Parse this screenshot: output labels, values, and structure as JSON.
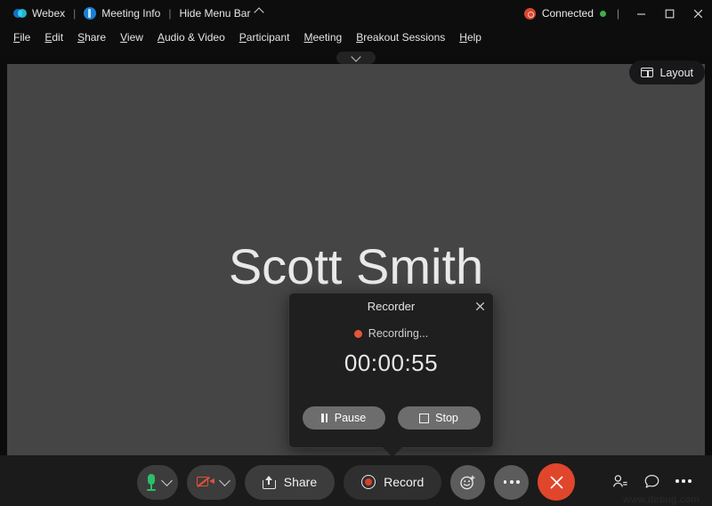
{
  "titlebar": {
    "app_name": "Webex",
    "separator1": "|",
    "meeting_info": "Meeting Info",
    "separator2": "|",
    "hide_menu_bar": "Hide Menu Bar",
    "connection_status": "Connected",
    "vbar": "|",
    "minimize_label": "Minimize",
    "maximize_label": "Maximize",
    "close_label": "Close",
    "accent_red": "#d6472f",
    "accent_green": "#3fae4a"
  },
  "menubar": {
    "items": [
      {
        "pre": "",
        "key": "F",
        "post": "ile"
      },
      {
        "pre": "",
        "key": "E",
        "post": "dit"
      },
      {
        "pre": "",
        "key": "S",
        "post": "hare"
      },
      {
        "pre": "",
        "key": "V",
        "post": "iew"
      },
      {
        "pre": "",
        "key": "A",
        "post": "udio & Video"
      },
      {
        "pre": "",
        "key": "P",
        "post": "articipant"
      },
      {
        "pre": "",
        "key": "M",
        "post": "eeting"
      },
      {
        "pre": "",
        "key": "B",
        "post": "reakout Sessions"
      },
      {
        "pre": "",
        "key": "H",
        "post": "elp"
      }
    ]
  },
  "stage": {
    "speaker_name": "Scott Smith",
    "background_color": "#454545",
    "collapse_toggle_label": "Collapse controls"
  },
  "layout": {
    "label": "Layout"
  },
  "recorder": {
    "title": "Recorder",
    "close_label": "Close recorder",
    "status_text": "Recording...",
    "status_dot_color": "#e8543c",
    "timer": "00:00:55",
    "pause_label": "Pause",
    "stop_label": "Stop"
  },
  "toolbar": {
    "mute_label": "Mute",
    "mic_menu_label": "Audio options",
    "video_label": "Start video",
    "video_menu_label": "Video options",
    "share_label": "Share",
    "record_label": "Record",
    "reactions_label": "Reactions",
    "more_label": "More options",
    "end_label": "End meeting",
    "participants_label": "Participants",
    "chat_label": "Chat",
    "more_right_label": "More",
    "end_button_color": "#e0462c",
    "mic_color": "#2bbf6a",
    "camera_color": "#e2513a"
  },
  "watermark": {
    "text": "www.debug.com"
  }
}
